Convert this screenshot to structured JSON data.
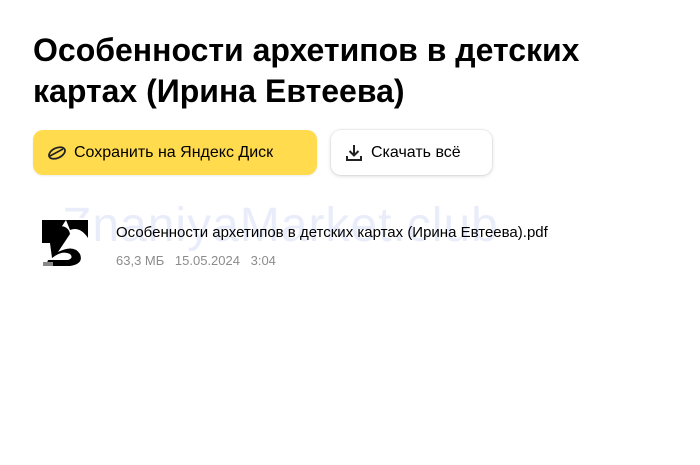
{
  "page": {
    "title": "Особенности архетипов в детских картах (Ирина Евтеева)"
  },
  "actions": {
    "save_label": "Сохранить на Яндекс Диск",
    "save_icon": "yandex-disk-icon",
    "download_label": "Скачать всё",
    "download_icon": "download-icon"
  },
  "file": {
    "name": "Особенности архетипов в детских картах (Ирина Евтеева).pdf",
    "size": "63,3 МБ",
    "date": "15.05.2024",
    "time": "3:04"
  },
  "watermark": "ZnaniyaMarket.club",
  "colors": {
    "accent": "#ffdb4d",
    "meta_text": "#8c8c8c"
  }
}
